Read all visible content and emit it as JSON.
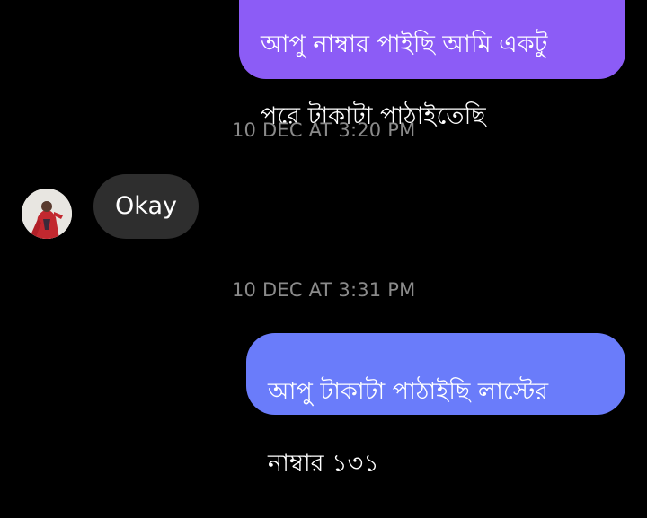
{
  "messages": {
    "sent_top": {
      "line1": "আপু নাম্বার পাইছি আমি একটু",
      "line2": "পরে টাকাটা পাঠাইতেছি"
    },
    "timestamp_1": "10 DEC AT 3:20 PM",
    "received": {
      "text": "Okay"
    },
    "timestamp_2": "10 DEC AT 3:31 PM",
    "sent_bottom": {
      "line1": "আপু টাকাটা পাঠাইছি লাস্টের",
      "line2": "নাম্বার ১৩১"
    }
  },
  "colors": {
    "background": "#000000",
    "sent_bubble_purple": "#8c5cf6",
    "sent_bubble_blue": "#6a7cfa",
    "received_bubble": "#2e2e2e",
    "timestamp_text": "#8a8a8a"
  }
}
